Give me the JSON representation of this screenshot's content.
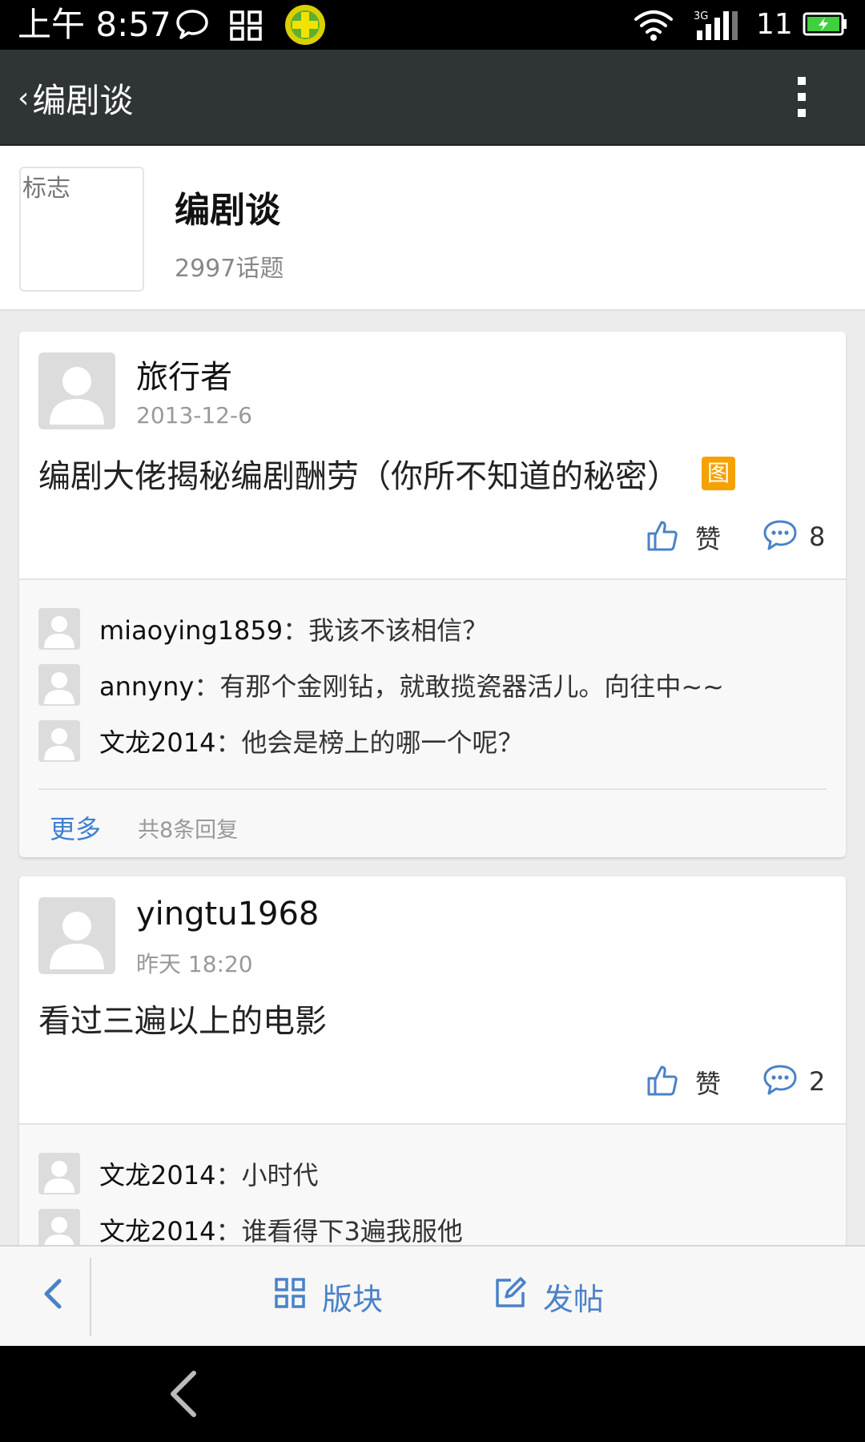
{
  "status_bar": {
    "time": "上午 8:57",
    "battery_level": "11",
    "network": "3G",
    "icons": [
      "chat-bubble-icon",
      "grid-icon",
      "360-security-icon",
      "wifi-icon",
      "signal-icon",
      "battery-icon"
    ]
  },
  "title_bar": {
    "title": "编剧谈",
    "icons": [
      "chevron-left-icon",
      "overflow-menu-icon"
    ]
  },
  "forum": {
    "logo_alt": "标志",
    "name": "编剧谈",
    "topic_count": "2997话题"
  },
  "posts": [
    {
      "author": "旅行者",
      "date": "2013-12-6",
      "title": "编剧大佬揭秘编剧酬劳（你所不知道的秘密）",
      "image_badge": "图",
      "like_label": "赞",
      "comment_count": "8",
      "replies": [
        {
          "user": "miaoying1859",
          "sep": "：",
          "text": "我该不该相信？"
        },
        {
          "user": "annyny",
          "sep": "：",
          "text": "有那个金刚钻，就敢揽瓷器活儿。向往中~~"
        },
        {
          "user": "文龙2014",
          "sep": "：",
          "text": "他会是榜上的哪一个呢？"
        }
      ],
      "more_label": "更多",
      "reply_total": "共8条回复"
    },
    {
      "author": "yingtu1968",
      "date": "昨天 18:20",
      "title": "看过三遍以上的电影",
      "like_label": "赞",
      "comment_count": "2",
      "replies": [
        {
          "user": "文龙2014",
          "sep": "：",
          "text": "小时代"
        },
        {
          "user": "文龙2014",
          "sep": "：",
          "text": "谁看得下3遍我服他"
        }
      ]
    }
  ],
  "toolbar": {
    "section_label": "版块",
    "post_label": "发帖"
  },
  "colors": {
    "title_bar_bg": "#2f3437",
    "accent_blue": "#4a82c8",
    "badge_orange": "#f5a100",
    "battery_green": "#3fd03f"
  }
}
